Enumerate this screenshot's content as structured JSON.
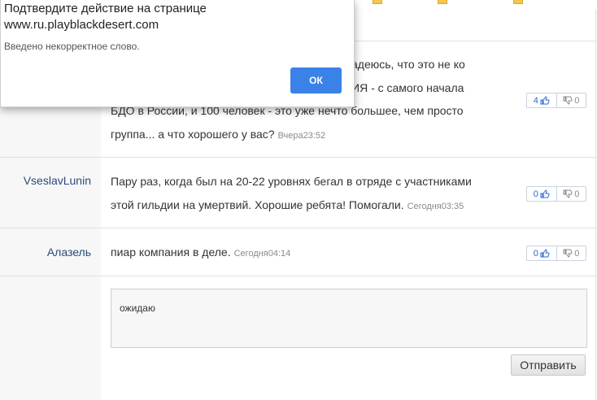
{
  "dialog": {
    "title_line1": "Подтвердите действие на странице",
    "title_line2": "www.ru.playblackdesert.com",
    "message": "Введено некорректное слово.",
    "ok_label": "ОК"
  },
  "comments": [
    {
      "author": "",
      "lines": [
        "адеюсь, что это не ко",
        "ИЯ - с самого начала",
        "БДО в России, и 100 человек - это уже нечто большее, чем просто",
        "группа... а что хорошего у вас?"
      ],
      "timestamp": "Вчера23:52",
      "likes": "4",
      "dislikes": "0"
    },
    {
      "author": "VseslavLunin",
      "lines": [
        "Пару раз, когда был на 20-22 уровнях бегал в отряде с участниками",
        "этой гильдии на умертвий. Хорошие ребята! Помогали."
      ],
      "timestamp": "Сегодня03:35",
      "likes": "0",
      "dislikes": "0"
    },
    {
      "author": "Алазель",
      "lines": [
        "пиар компания в деле."
      ],
      "timestamp": "Сегодня04:14",
      "likes": "0",
      "dislikes": "0"
    }
  ],
  "reply": {
    "value": "ожидаю",
    "send_label": "Отправить"
  },
  "icons": {
    "like": "thumbs-up-icon",
    "dislike": "thumbs-down-icon",
    "folder": "folder-icon"
  },
  "colors": {
    "accent": "#3b82e8",
    "author": "#2b4a7a",
    "like": "#2a6ad6"
  }
}
